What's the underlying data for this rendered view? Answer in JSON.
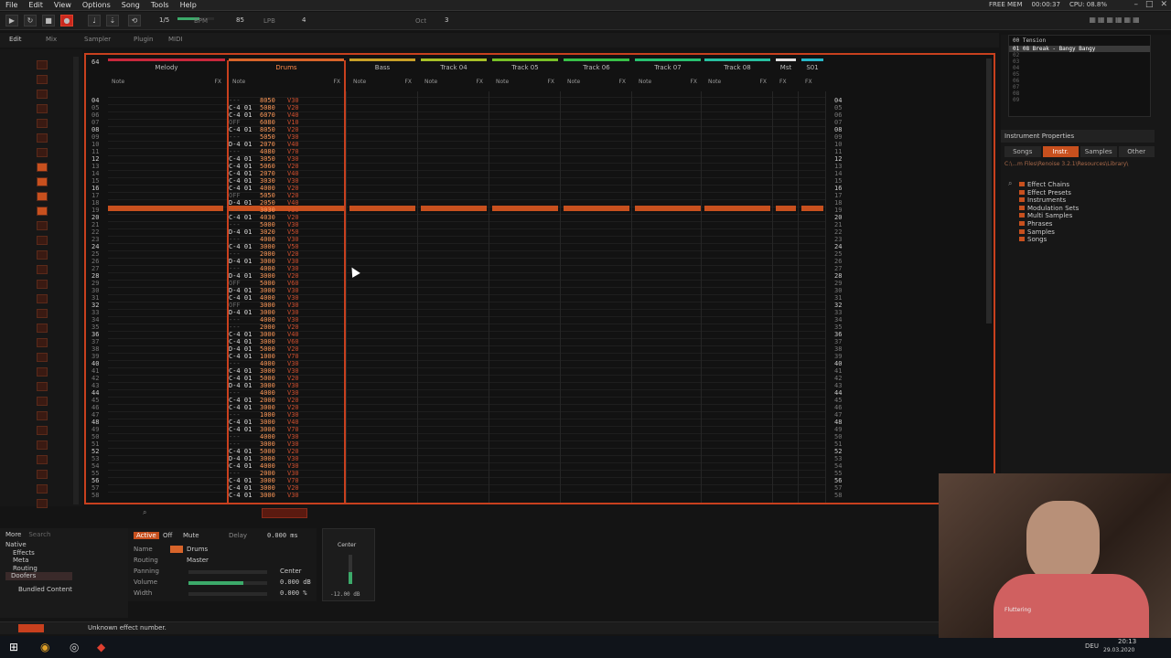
{
  "menubar": {
    "items": [
      "File",
      "Edit",
      "View",
      "Options",
      "Song",
      "Tools",
      "Help"
    ]
  },
  "status": {
    "text": "Unknown effect number.",
    "cpu": "CPU: 08.8%",
    "time": "00:00:37",
    "free": "FREE MEM"
  },
  "transport": {
    "bpm_label": "BPM",
    "bpm": "85",
    "lpb_label": "LPB",
    "lpb": "4",
    "oct_label": "Oct",
    "oct": "3",
    "pattern_pos": "1/5"
  },
  "tabs": [
    "Edit",
    "Mix",
    "Sampler",
    "Plugin",
    "MIDI"
  ],
  "tracks": [
    {
      "name": "Melody",
      "color": "#c8283c"
    },
    {
      "name": "Drums",
      "color": "#d8642a"
    },
    {
      "name": "Bass",
      "color": "#c8a028"
    },
    {
      "name": "Track 04",
      "color": "#a8c028"
    },
    {
      "name": "Track 05",
      "color": "#78c028"
    },
    {
      "name": "Track 06",
      "color": "#38c048"
    },
    {
      "name": "Track 07",
      "color": "#28c070"
    },
    {
      "name": "Track 08",
      "color": "#28c0a0"
    },
    {
      "name": "Mst",
      "color": "#e0e0e0"
    },
    {
      "name": "S01",
      "color": "#28b8c8"
    }
  ],
  "track_sub": {
    "note": "Note",
    "fx": "FX"
  },
  "pattern_length": "64",
  "row_numbers": [
    "04",
    "05",
    "06",
    "07",
    "08",
    "09",
    "10",
    "11",
    "12",
    "13",
    "14",
    "15",
    "16",
    "17",
    "18",
    "19",
    "20",
    "21",
    "22",
    "23",
    "24",
    "25",
    "26",
    "27",
    "28",
    "29",
    "30",
    "31",
    "32",
    "33",
    "34",
    "35",
    "36",
    "37",
    "38",
    "39",
    "40",
    "41",
    "42",
    "43",
    "44",
    "45",
    "46",
    "47",
    "48",
    "49",
    "50",
    "51",
    "52",
    "53",
    "54",
    "55",
    "56",
    "57",
    "58"
  ],
  "drum_rows": [
    [
      "---",
      "8050",
      "V30"
    ],
    [
      "C-4 01",
      "5080",
      "V20"
    ],
    [
      "C-4 01",
      "6070",
      "V40"
    ],
    [
      "OFF",
      "6080",
      "V10"
    ],
    [
      "C-4 01",
      "8050",
      "V20"
    ],
    [
      "---",
      "5050",
      "V30"
    ],
    [
      "D-4 01",
      "2070",
      "V40"
    ],
    [
      "---",
      "4080",
      "V70"
    ],
    [
      "C-4 01",
      "3050",
      "V30"
    ],
    [
      "C-4 01",
      "5060",
      "V20"
    ],
    [
      "C-4 01",
      "2070",
      "V40"
    ],
    [
      "C-4 01",
      "3030",
      "V30"
    ],
    [
      "C-4 01",
      "4000",
      "V20"
    ],
    [
      "OFF",
      "5050",
      "V20"
    ],
    [
      "D-4 01",
      "2050",
      "V40"
    ],
    [
      "---",
      "3030",
      "V30"
    ],
    [
      "C-4 01",
      "4030",
      "V20"
    ],
    [
      "---",
      "5000",
      "V30"
    ],
    [
      "D-4 01",
      "3020",
      "V50"
    ],
    [
      "---",
      "4000",
      "V30"
    ],
    [
      "C-4 01",
      "3000",
      "V50"
    ],
    [
      "---",
      "2000",
      "V20"
    ],
    [
      "D-4 01",
      "3000",
      "V30"
    ],
    [
      "---",
      "4000",
      "V30"
    ],
    [
      "D-4 01",
      "3000",
      "V20"
    ],
    [
      "OFF",
      "5000",
      "V60"
    ],
    [
      "D-4 01",
      "3000",
      "V30"
    ],
    [
      "C-4 01",
      "4000",
      "V30"
    ],
    [
      "OFF",
      "3000",
      "V30"
    ],
    [
      "D-4 01",
      "3000",
      "V30"
    ],
    [
      "---",
      "4000",
      "V30"
    ],
    [
      "---",
      "2000",
      "V20"
    ],
    [
      "C-4 01",
      "3000",
      "V40"
    ],
    [
      "C-4 01",
      "3000",
      "V60"
    ],
    [
      "D-4 01",
      "5000",
      "V20"
    ],
    [
      "C-4 01",
      "1000",
      "V70"
    ],
    [
      "---",
      "4000",
      "V30"
    ],
    [
      "C-4 01",
      "3000",
      "V30"
    ],
    [
      "C-4 01",
      "5000",
      "V20"
    ],
    [
      "D-4 01",
      "3000",
      "V30"
    ],
    [
      "---",
      "4000",
      "V30"
    ],
    [
      "C-4 01",
      "2000",
      "V20"
    ],
    [
      "C-4 01",
      "3000",
      "V20"
    ],
    [
      "---",
      "1000",
      "V30"
    ],
    [
      "C-4 01",
      "3000",
      "V40"
    ],
    [
      "C-4 01",
      "3000",
      "V70"
    ],
    [
      "---",
      "4000",
      "V30"
    ],
    [
      "---",
      "3000",
      "V30"
    ],
    [
      "C-4 01",
      "5000",
      "V20"
    ],
    [
      "D-4 01",
      "3000",
      "V30"
    ],
    [
      "C-4 01",
      "4000",
      "V30"
    ],
    [
      "---",
      "2000",
      "V30"
    ],
    [
      "C-4 01",
      "3000",
      "V70"
    ],
    [
      "C-4 01",
      "3000",
      "V20"
    ],
    [
      "C-4 01",
      "3000",
      "V30"
    ]
  ],
  "right": {
    "instruments": [
      "00 Tension",
      "01 08 Break - Bangy Bangy",
      "02",
      "03",
      "04",
      "05",
      "06",
      "07",
      "08",
      "09"
    ],
    "props_title": "Instrument Properties",
    "browser_tabs": [
      "Songs",
      "Instr.",
      "Samples",
      "Other"
    ],
    "path": "C:\\...m Files\\Renoise 3.2.1\\Resources\\Library\\",
    "folders": [
      "Effect Chains",
      "Effect Presets",
      "Instruments",
      "Modulation Sets",
      "Multi Samples",
      "Phrases",
      "Samples",
      "Songs"
    ]
  },
  "dsp": {
    "tabs": [
      "More",
      "Search"
    ],
    "tree": [
      "Native",
      "Effects",
      "Meta",
      "Routing",
      "Doofers",
      "Bundled Content"
    ]
  },
  "track_props": {
    "active": "Active",
    "off": "Off",
    "mute": "Mute",
    "delay_label": "Delay",
    "delay": "0.000 ms",
    "name_label": "Name",
    "name": "Drums",
    "routing_label": "Routing",
    "routing": "Master",
    "panning_label": "Panning",
    "panning": "Center",
    "volume_label": "Volume",
    "volume": "0.000 dB",
    "width_label": "Width",
    "width": "0.000 %",
    "volume_level": 0.7
  },
  "vu": {
    "label": "Center",
    "db": "-12.00 dB"
  },
  "taskbar": {
    "lang": "DEU",
    "time": "20:13",
    "date": "29.03.2020"
  },
  "webcam": {
    "text": "Fluttering"
  }
}
